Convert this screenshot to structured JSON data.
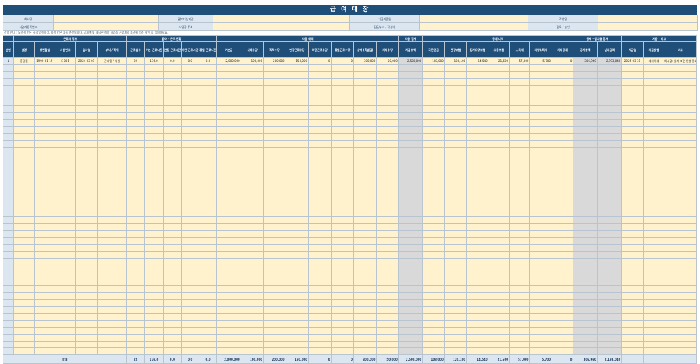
{
  "title": "급 여 대 장",
  "info": {
    "row1": [
      "회사명",
      "관리대상기간",
      "지급기준일",
      "작성일"
    ],
    "row2": [
      "사업자등록번호",
      "사업장 주소",
      "담당부서 / 작성자",
      "검토 / 승인"
    ]
  },
  "note": "작성 안내 : 노란색 칸은 직접 입력하고, 회색 칸은 자동 계산됩니다. 공제액 및 세금은 해당 사업장 근로계약 조건에 따라 확인 후 입력하세요.",
  "groups": [
    "근로자 정보",
    "급여 · 근무 현황",
    "지급 내역",
    "지급 합계",
    "공제 내역",
    "공제 · 실지급 합계",
    "지급 · 비고"
  ],
  "headers": [
    "순번",
    "성명",
    "생년월일",
    "사원번호",
    "입사일",
    "부서 / 직위",
    "근로일수",
    "기본 근로시간",
    "연장 근로시간",
    "야간 근로시간",
    "휴일 근로시간",
    "기본급",
    "식대수당",
    "직책수당",
    "연장근로수당",
    "야간근로수당",
    "휴일근로수당",
    "상여 (특별급)",
    "기타수당",
    "지급총액",
    "국민연금",
    "건강보험",
    "장기요양보험",
    "고용보험",
    "소득세",
    "지방소득세",
    "기타공제",
    "공제총액",
    "실지급액",
    "지급일",
    "지급방법",
    "비고"
  ],
  "employee": {
    "seq": "1",
    "name": "홍길동",
    "birth": "1990-01-15",
    "emp_no": "E-001",
    "hire": "2024-03-01",
    "dept": "관리팀 / 사원",
    "days": "22",
    "basic_hours": "176.0",
    "overtime_hours": "0.0",
    "night_hours": "0.0",
    "holiday_hours": "0.0",
    "base_pay": "2,000,000",
    "meal": "100,000",
    "position_allow": "200,000",
    "overtime_pay": "150,000",
    "night_pay": "0",
    "holiday_pay": "0",
    "bonus": "300,000",
    "other_allow": "50,000",
    "gross": "2,500,000",
    "pension": "108,000",
    "health": "120,100",
    "care": "14,540",
    "employment": "21,600",
    "income_tax": "57,000",
    "local_tax": "5,700",
    "other_ded": "0",
    "total_ded": "306,960",
    "net": "2,193,040",
    "pay_date": "2025-03-31",
    "pay_method": "계좌이체",
    "remark": "예시값: 실제 조건 반영 필요"
  },
  "totals": {
    "label": "합계",
    "values": [
      "22",
      "176.0",
      "0.0",
      "0.0",
      "0.0",
      "2,000,000",
      "100,000",
      "200,000",
      "150,000",
      "0",
      "0",
      "300,000",
      "50,000",
      "2,500,000",
      "108,000",
      "120,100",
      "14,540",
      "21,600",
      "57,000",
      "5,700",
      "0",
      "306,960",
      "2,193,040"
    ]
  },
  "colors": {
    "header": "#1f4e79",
    "input": "#fff2cc",
    "computed": "#d9d9d9",
    "label": "#dce6f1"
  }
}
